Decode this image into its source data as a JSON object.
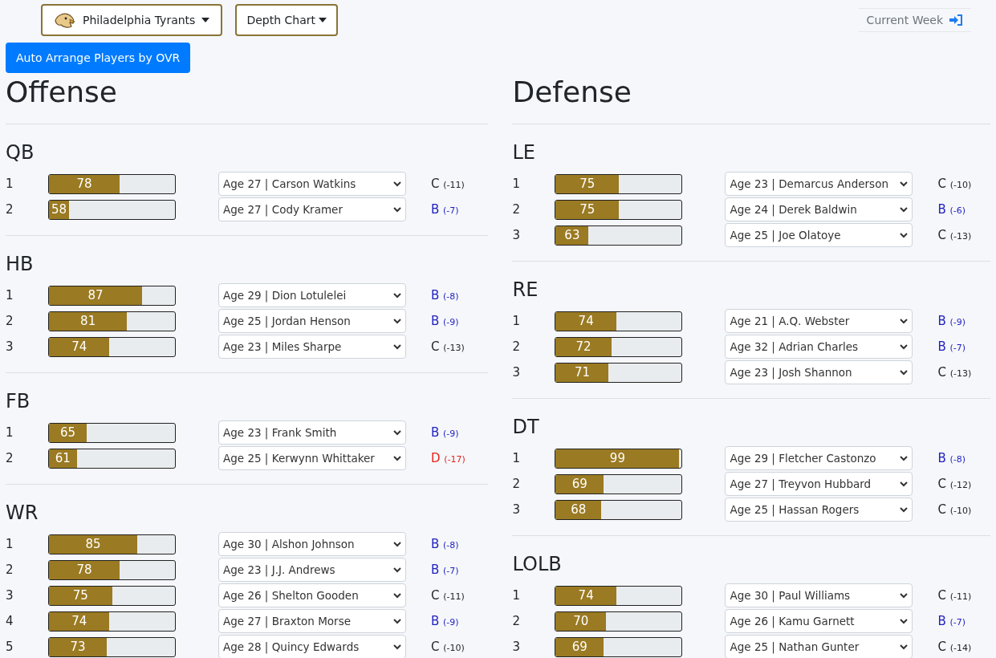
{
  "header": {
    "team_menu": "Philadelphia Tyrants",
    "view_menu": "Depth Chart",
    "current_week": "Current Week"
  },
  "auto_button": "Auto Arrange Players by OVR",
  "units": [
    {
      "title": "Offense",
      "groups": [
        {
          "position": "QB",
          "rows": [
            {
              "slot": "1",
              "ovr": "78",
              "level": 0.56,
              "player": "Age 27 | Carson Watkins",
              "grade": "C",
              "diff": "(-11)",
              "color": "#212529"
            },
            {
              "slot": "2",
              "ovr": "58",
              "level": 0.16,
              "player": "Age 27 | Cody Kramer",
              "grade": "B",
              "diff": "(-7)",
              "color": "#1f1fbf"
            }
          ]
        },
        {
          "position": "HB",
          "rows": [
            {
              "slot": "1",
              "ovr": "87",
              "level": 0.74,
              "player": "Age 29 | Dion Lotulelei",
              "grade": "B",
              "diff": "(-8)",
              "color": "#1f1fbf"
            },
            {
              "slot": "2",
              "ovr": "81",
              "level": 0.62,
              "player": "Age 25 | Jordan Henson",
              "grade": "B",
              "diff": "(-9)",
              "color": "#1f1fbf"
            },
            {
              "slot": "3",
              "ovr": "74",
              "level": 0.48,
              "player": "Age 23 | Miles Sharpe",
              "grade": "C",
              "diff": "(-13)",
              "color": "#212529"
            }
          ]
        },
        {
          "position": "FB",
          "rows": [
            {
              "slot": "1",
              "ovr": "65",
              "level": 0.3,
              "player": "Age 23 | Frank Smith",
              "grade": "B",
              "diff": "(-9)",
              "color": "#1f1fbf"
            },
            {
              "slot": "2",
              "ovr": "61",
              "level": 0.22,
              "player": "Age 25 | Kerwynn Whittaker",
              "grade": "D",
              "diff": "(-17)",
              "color": "#e8221b"
            }
          ]
        },
        {
          "position": "WR",
          "rows": [
            {
              "slot": "1",
              "ovr": "85",
              "level": 0.7,
              "player": "Age 30 | Alshon Johnson",
              "grade": "B",
              "diff": "(-8)",
              "color": "#1f1fbf"
            },
            {
              "slot": "2",
              "ovr": "78",
              "level": 0.56,
              "player": "Age 23 | J.J. Andrews",
              "grade": "B",
              "diff": "(-7)",
              "color": "#1f1fbf"
            },
            {
              "slot": "3",
              "ovr": "75",
              "level": 0.5,
              "player": "Age 26 | Shelton Gooden",
              "grade": "C",
              "diff": "(-11)",
              "color": "#212529"
            },
            {
              "slot": "4",
              "ovr": "74",
              "level": 0.48,
              "player": "Age 27 | Braxton Morse",
              "grade": "B",
              "diff": "(-9)",
              "color": "#1f1fbf"
            },
            {
              "slot": "5",
              "ovr": "73",
              "level": 0.46,
              "player": "Age 28 | Quincy Edwards",
              "grade": "C",
              "diff": "(-10)",
              "color": "#212529"
            }
          ]
        }
      ]
    },
    {
      "title": "Defense",
      "groups": [
        {
          "position": "LE",
          "rows": [
            {
              "slot": "1",
              "ovr": "75",
              "level": 0.5,
              "player": "Age 23 | Demarcus Anderson",
              "grade": "C",
              "diff": "(-10)",
              "color": "#212529"
            },
            {
              "slot": "2",
              "ovr": "75",
              "level": 0.5,
              "player": "Age 24 | Derek Baldwin",
              "grade": "B",
              "diff": "(-6)",
              "color": "#1f1fbf"
            },
            {
              "slot": "3",
              "ovr": "63",
              "level": 0.26,
              "player": "Age 25 | Joe Olatoye",
              "grade": "C",
              "diff": "(-13)",
              "color": "#212529"
            }
          ]
        },
        {
          "position": "RE",
          "rows": [
            {
              "slot": "1",
              "ovr": "74",
              "level": 0.48,
              "player": "Age 21 | A.Q. Webster",
              "grade": "B",
              "diff": "(-9)",
              "color": "#1f1fbf"
            },
            {
              "slot": "2",
              "ovr": "72",
              "level": 0.44,
              "player": "Age 32 | Adrian Charles",
              "grade": "B",
              "diff": "(-7)",
              "color": "#1f1fbf"
            },
            {
              "slot": "3",
              "ovr": "71",
              "level": 0.42,
              "player": "Age 23 | Josh Shannon",
              "grade": "C",
              "diff": "(-13)",
              "color": "#212529"
            }
          ]
        },
        {
          "position": "DT",
          "rows": [
            {
              "slot": "1",
              "ovr": "99",
              "level": 0.98,
              "player": "Age 29 | Fletcher Castonzo",
              "grade": "B",
              "diff": "(-8)",
              "color": "#1f1fbf"
            },
            {
              "slot": "2",
              "ovr": "69",
              "level": 0.38,
              "player": "Age 27 | Treyvon Hubbard",
              "grade": "C",
              "diff": "(-12)",
              "color": "#212529"
            },
            {
              "slot": "3",
              "ovr": "68",
              "level": 0.36,
              "player": "Age 25 | Hassan Rogers",
              "grade": "C",
              "diff": "(-10)",
              "color": "#212529"
            }
          ]
        },
        {
          "position": "LOLB",
          "rows": [
            {
              "slot": "1",
              "ovr": "74",
              "level": 0.48,
              "player": "Age 30 | Paul Williams",
              "grade": "C",
              "diff": "(-11)",
              "color": "#212529"
            },
            {
              "slot": "2",
              "ovr": "70",
              "level": 0.4,
              "player": "Age 26 | Kamu Garnett",
              "grade": "B",
              "diff": "(-7)",
              "color": "#1f1fbf"
            },
            {
              "slot": "3",
              "ovr": "69",
              "level": 0.38,
              "player": "Age 25 | Nathan Gunter",
              "grade": "C",
              "diff": "(-14)",
              "color": "#212529"
            }
          ]
        }
      ]
    }
  ]
}
